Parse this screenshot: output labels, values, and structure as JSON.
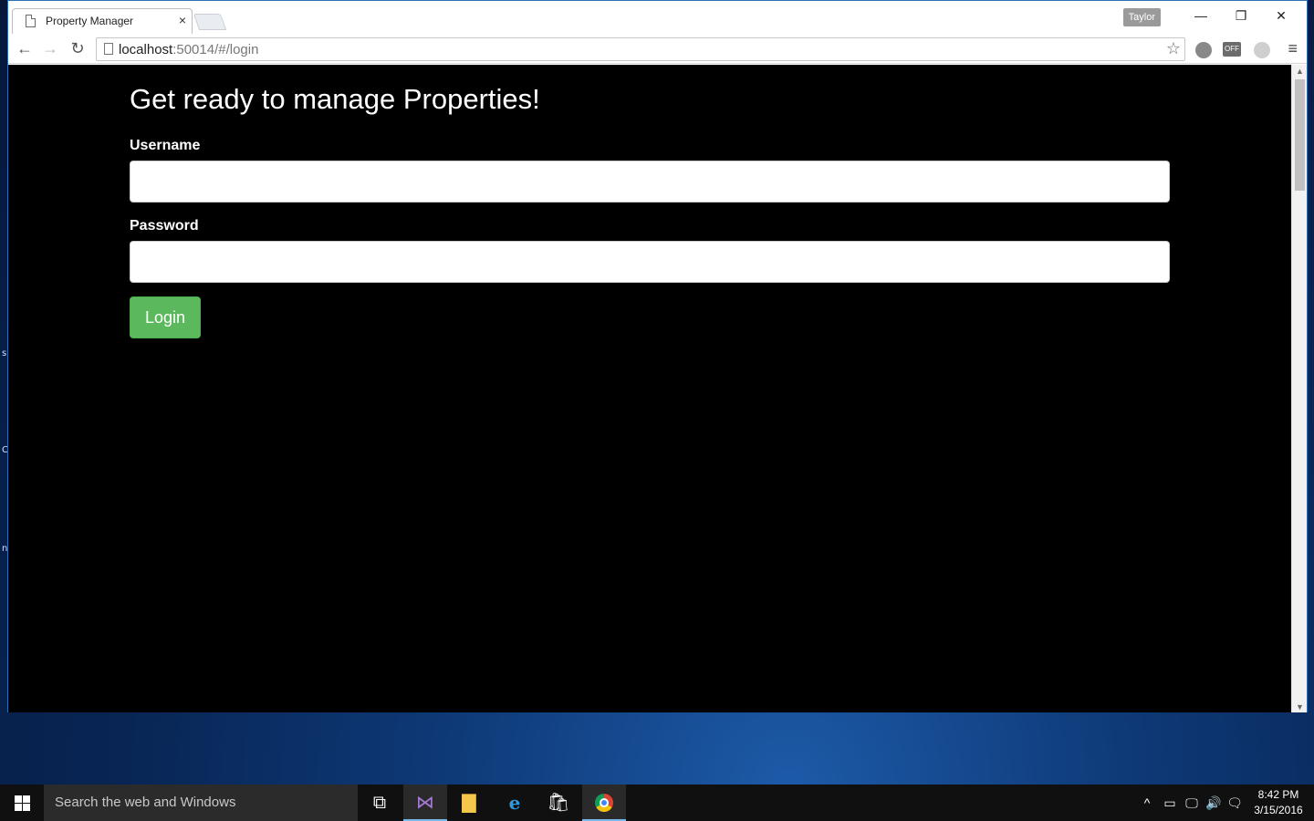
{
  "browser": {
    "tab_title": "Property Manager",
    "tab_close": "×",
    "profile_name": "Taylor",
    "window_controls": {
      "minimize": "—",
      "maximize": "❐",
      "close": "✕"
    },
    "nav": {
      "back": "←",
      "forward": "→",
      "reload": "↻"
    },
    "url_host": "localhost",
    "url_rest": ":50014/#/login",
    "star": "☆",
    "menu": "≡",
    "ext_off": "OFF"
  },
  "page": {
    "heading": "Get ready to manage Properties!",
    "username_label": "Username",
    "password_label": "Password",
    "username_value": "",
    "password_value": "",
    "login_button": "Login"
  },
  "desktop": {
    "glyphs": [
      "s",
      "C",
      "n"
    ]
  },
  "taskbar": {
    "search_placeholder": "Search the web and Windows",
    "icons": {
      "taskview": "⧉",
      "visual_studio": "⋈",
      "file_explorer": "▇",
      "edge": "e",
      "store": "🛍"
    },
    "tray": {
      "chevron": "^",
      "battery": "▭",
      "network": "🖵",
      "volume": "🔊",
      "notifications": "🗨"
    },
    "clock_time": "8:42 PM",
    "clock_date": "3/15/2016"
  },
  "colors": {
    "login_button": "#5cb85c",
    "page_background": "#000000",
    "window_border": "#2b6fb8"
  }
}
